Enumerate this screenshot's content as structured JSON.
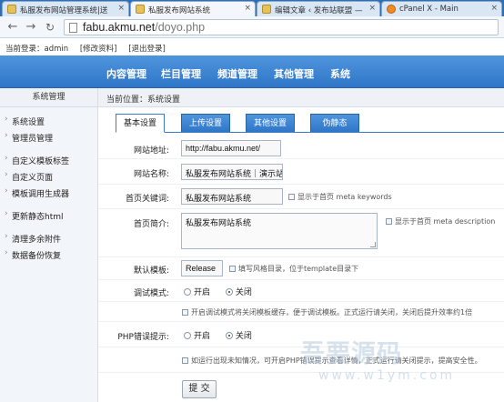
{
  "browser": {
    "tabs": [
      {
        "title": "私服发布网站管理系统|送",
        "close": "×"
      },
      {
        "title": "私服发布网站系统",
        "close": "×"
      },
      {
        "title": "编辑文章 ‹ 发布站联盟 —",
        "close": "×"
      },
      {
        "title": "cPanel X - Main",
        "close": "×"
      }
    ],
    "url_domain": "fabu.akmu.net",
    "url_path": "/doyo.php"
  },
  "loginbar": {
    "current_login": "当前登录：admin",
    "edit_profile": "[修改资料]",
    "logout": "[退出登录]"
  },
  "topnav": {
    "items": [
      "内容管理",
      "栏目管理",
      "频道管理",
      "其他管理",
      "系统"
    ]
  },
  "sidebar": {
    "title": "系统管理",
    "items": [
      "系统设置",
      "管理员管理",
      "自定义模板标签",
      "自定义页面",
      "模板调用生成器",
      "更新静态html",
      "清理多余附件",
      "数据备份恢复"
    ]
  },
  "breadcrumb": "当前位置：系统设置",
  "form_tabs": [
    "基本设置",
    "上传设置",
    "其他设置",
    "伪静态"
  ],
  "form": {
    "site_url_label": "网站地址:",
    "site_url_value": "http://fabu.akmu.net/",
    "site_name_label": "网站名称:",
    "site_name_value": "私服发布网站系统｜演示站",
    "keywords_label": "首页关键词:",
    "keywords_value": "私服发布网站系统",
    "keywords_hint": "显示于首页 meta keywords",
    "intro_label": "首页简介:",
    "intro_value": "私服发布网站系统",
    "intro_hint": "显示于首页 meta description",
    "template_label": "默认模板:",
    "template_value": "Release",
    "template_hint": "填写风格目录，位于template目录下",
    "debug_label": "调试模式:",
    "debug_options": [
      "开启",
      "关闭"
    ],
    "debug_selected": "关闭",
    "debug_hint": "开启调试模式将关闭模板缓存，便于调试模板。正式运行请关闭，关闭后提升效率约1倍",
    "php_error_label": "PHP错误提示:",
    "php_error_options": [
      "开启",
      "关闭"
    ],
    "php_error_selected": "关闭",
    "php_error_hint": "如运行出现未知情况，可开启PHP错误提示查看详情，正式运行请关闭提示，提高安全性。",
    "submit_label": "提 交"
  },
  "watermark": {
    "text": "吾要源码",
    "url": "www.w1ym.com"
  }
}
